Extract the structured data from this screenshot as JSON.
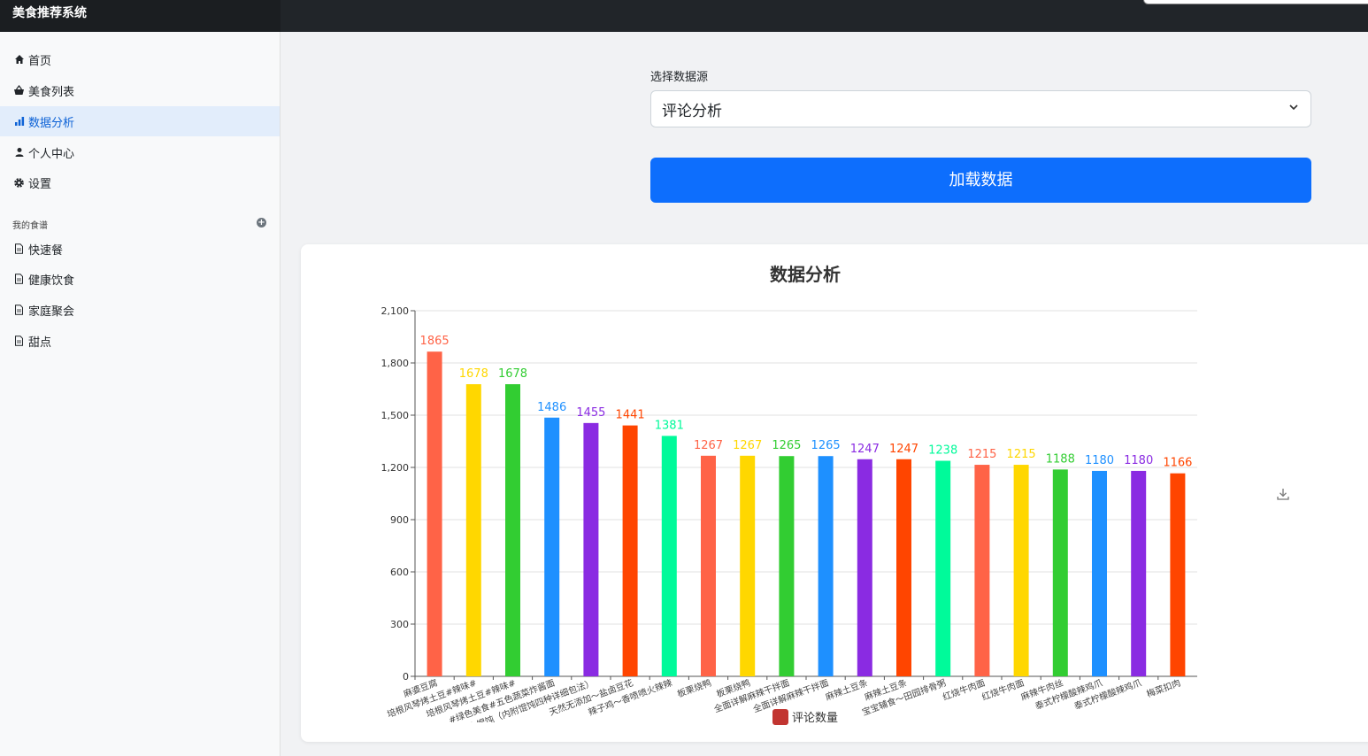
{
  "app": {
    "title": "美食推荐系统"
  },
  "sidebar": {
    "items": [
      {
        "label": "首页",
        "icon": "home-icon"
      },
      {
        "label": "美食列表",
        "icon": "basket-icon"
      },
      {
        "label": "数据分析",
        "icon": "bar-chart-icon",
        "active": true
      },
      {
        "label": "个人中心",
        "icon": "user-icon"
      },
      {
        "label": "设置",
        "icon": "gear-icon"
      }
    ],
    "section_title": "我的食谱",
    "recipes": [
      {
        "label": "快速餐",
        "icon": "document-icon"
      },
      {
        "label": "健康饮食",
        "icon": "document-icon"
      },
      {
        "label": "家庭聚会",
        "icon": "document-icon"
      },
      {
        "label": "甜点",
        "icon": "document-icon"
      }
    ]
  },
  "form": {
    "select_label": "选择数据源",
    "select_value": "评论分析",
    "load_button": "加载数据"
  },
  "chart_data": {
    "type": "bar",
    "title": "数据分析",
    "categories": [
      "麻婆豆腐",
      "培根风琴烤土豆#辣味#",
      "培根风琴烤土豆#辣味#",
      "#绿色美食#五色蔬菜炸酱面",
      "鲜肉小馄饨（内附馄饨四种详细包法）",
      "天然无添加～盐卤豆花",
      "辣子鸡～香喷喷火辣辣",
      "板栗烧鸭",
      "板栗烧鸭",
      "全面详解麻辣干拌面",
      "全面详解麻辣干拌面",
      "麻辣土豆条",
      "麻辣土豆条",
      "宝宝辅食～田园排骨粥",
      "红烧牛肉面",
      "红烧牛肉面",
      "麻辣牛肉丝",
      "泰式柠檬酸辣鸡爪",
      "泰式柠檬酸辣鸡爪",
      "梅菜扣肉"
    ],
    "series": [
      {
        "name": "评论数量",
        "values": [
          1865,
          1678,
          1678,
          1486,
          1455,
          1441,
          1381,
          1267,
          1267,
          1265,
          1265,
          1247,
          1247,
          1238,
          1215,
          1215,
          1188,
          1180,
          1180,
          1166
        ]
      }
    ],
    "colors": [
      "#ff6347",
      "#ffd700",
      "#32cd32",
      "#1e90ff",
      "#8a2be2",
      "#ff4500",
      "#00fa9a"
    ],
    "ylim": [
      0,
      2100
    ],
    "yticks": [
      "0",
      "300",
      "600",
      "900",
      "1,200",
      "1,500",
      "1,800",
      "2,100"
    ],
    "legend_color": "#c23531",
    "grid": true,
    "legend": "bottom"
  }
}
